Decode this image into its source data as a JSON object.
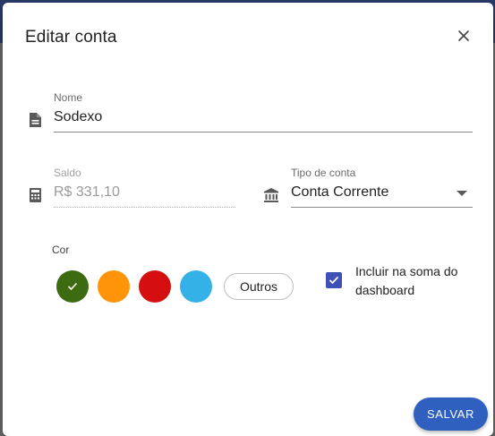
{
  "dialog": {
    "title": "Editar conta",
    "close_icon": "close-icon"
  },
  "fields": {
    "nome": {
      "label": "Nome",
      "value": "Sodexo",
      "icon": "document-icon"
    },
    "saldo": {
      "label": "Saldo",
      "value": "R$ 331,10",
      "icon": "calculator-icon",
      "disabled": true
    },
    "tipo": {
      "label": "Tipo de conta",
      "value": "Conta Corrente",
      "icon": "bank-icon"
    }
  },
  "cor": {
    "label": "Cor",
    "swatches": [
      {
        "color": "#3d6b12",
        "selected": true
      },
      {
        "color": "#ff9408",
        "selected": false
      },
      {
        "color": "#d50f0f",
        "selected": false
      },
      {
        "color": "#34b1e6",
        "selected": false
      }
    ],
    "other_label": "Outros"
  },
  "dashboard": {
    "label": "Incluir na soma do dashboard",
    "checked": true
  },
  "actions": {
    "save_label": "SALVAR"
  }
}
